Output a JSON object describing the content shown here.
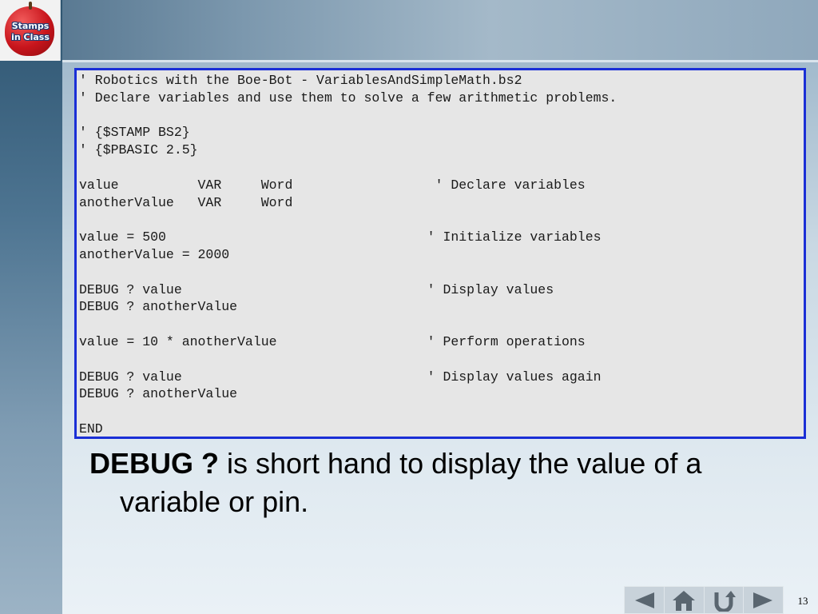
{
  "logo": {
    "line1": "Stamps",
    "line2": "in Class"
  },
  "code_lines": [
    "' Robotics with the Boe-Bot - VariablesAndSimpleMath.bs2",
    "' Declare variables and use them to solve a few arithmetic problems.",
    "",
    "' {$STAMP BS2}",
    "' {$PBASIC 2.5}",
    "",
    "value          VAR     Word                  ' Declare variables",
    "anotherValue   VAR     Word",
    "",
    "value = 500                                 ' Initialize variables",
    "anotherValue = 2000",
    "",
    "DEBUG ? value                               ' Display values",
    "DEBUG ? anotherValue",
    "",
    "value = 10 * anotherValue                   ' Perform operations",
    "",
    "DEBUG ? value                               ' Display values again",
    "DEBUG ? anotherValue",
    "",
    "END"
  ],
  "caption": {
    "bold": "DEBUG ?",
    "line1_rest": " is short hand to display the value of a",
    "line2": "variable or pin."
  },
  "nav": {
    "icons": [
      "arrow-left-icon",
      "home-icon",
      "return-icon",
      "arrow-right-icon"
    ]
  },
  "page_number": "13",
  "colors": {
    "panel_border": "#1a2fd6",
    "panel_bg": "#e6e6e6",
    "nav_icon": "#5a6670"
  }
}
